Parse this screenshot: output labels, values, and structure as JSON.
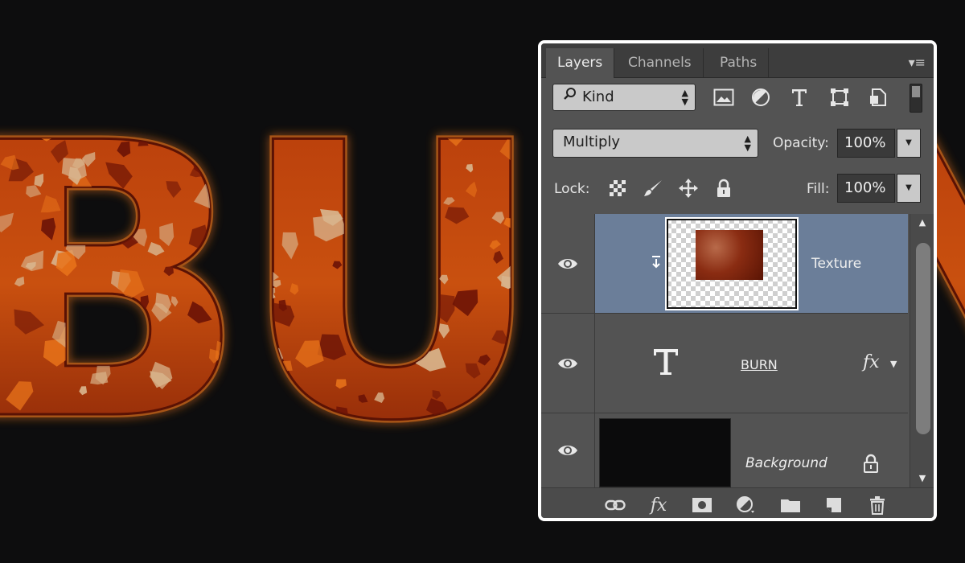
{
  "artwork": {
    "text": "BURN",
    "colors": {
      "fire": "#c84810",
      "glow": "#e8731a",
      "rust": "#6e1406",
      "flake": "#d8b48c"
    }
  },
  "panel": {
    "tabs": [
      {
        "label": "Layers",
        "active": true
      },
      {
        "label": "Channels",
        "active": false
      },
      {
        "label": "Paths",
        "active": false
      }
    ],
    "menu_icon": "panel-menu-icon",
    "filter": {
      "kind_label": "Kind",
      "icons": [
        "pixel-filter-icon",
        "adjustment-filter-icon",
        "type-filter-icon",
        "shape-filter-icon",
        "smart-object-filter-icon"
      ]
    },
    "blend_mode": "Multiply",
    "opacity_label": "Opacity:",
    "opacity_value": "100%",
    "lock_label": "Lock:",
    "lock_icons": [
      "lock-transparent-icon",
      "lock-image-icon",
      "lock-position-icon",
      "lock-all-icon"
    ],
    "fill_label": "Fill:",
    "fill_value": "100%",
    "layers": [
      {
        "name": "Texture",
        "selected": true,
        "clipped": true,
        "type": "pixel"
      },
      {
        "name": "BURN",
        "selected": false,
        "type": "text",
        "has_effects": true,
        "fx_label": "fx"
      },
      {
        "name": "Background",
        "selected": false,
        "type": "background",
        "locked": true
      }
    ],
    "bottom_icons": [
      "link-layers-icon",
      "layer-style-icon",
      "add-mask-icon",
      "new-adjustment-icon",
      "new-group-icon",
      "new-layer-icon",
      "delete-layer-icon"
    ],
    "bottom_fx_label": "fx",
    "accent_selected": "#6b7e99"
  }
}
